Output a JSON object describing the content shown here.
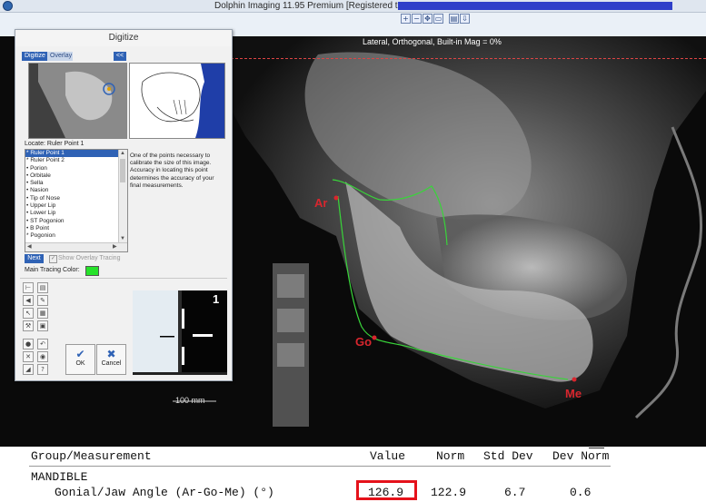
{
  "window": {
    "title": "Dolphin Imaging 11.95 Premium [Registered to:",
    "title_redacted": true
  },
  "toolbar": {
    "buttons": [
      {
        "icon": "zoom-in-icon",
        "glyph": "+"
      },
      {
        "icon": "zoom-out-icon",
        "glyph": "−"
      },
      {
        "icon": "pan-icon",
        "glyph": "✥"
      },
      {
        "icon": "fit-icon",
        "glyph": "▭"
      },
      {
        "icon": "print-icon",
        "glyph": "▤"
      },
      {
        "icon": "export-icon",
        "glyph": "⇩"
      }
    ]
  },
  "image": {
    "caption": "Lateral, Orthogonal, Built-in Mag = 0%",
    "scale_label": "100 mm",
    "landmarks": {
      "ar": "Ar",
      "go": "Go",
      "me": "Me"
    },
    "tracing_color": "#39d43a",
    "landmark_color": "#d8262e"
  },
  "digitize": {
    "title": "Digitize",
    "tabs": [
      "Digitize",
      "Overlay"
    ],
    "collapse_label": "<<",
    "locate_label": "Locate:  Ruler Point 1",
    "points": [
      "* Ruler Point 1",
      "* Ruler Point 2",
      "• Porion",
      "• Orbitale",
      "• Sella",
      "• Nasion",
      "• Tip of Nose",
      "• Upper Lip",
      "• Lower Lip",
      "• ST Pogonion",
      "• B Point",
      "* Pogonion"
    ],
    "selected_index": 0,
    "description": "One of the points necessary to calibrate the size of this image. Accuracy in locating this point determines the accuracy of your final measurements.",
    "next_label": "Next",
    "show_overlay_label": "Show Overlay Tracing",
    "show_overlay_checked": true,
    "main_color_label": "Main Tracing Color:",
    "main_color": "#26e22a",
    "ok_label": "OK",
    "cancel_label": "Cancel",
    "zoom_number": "1",
    "tools": [
      {
        "icon": "ruler-icon",
        "glyph": "⊢"
      },
      {
        "icon": "document-icon",
        "glyph": "▤"
      },
      {
        "icon": "speaker-icon",
        "glyph": "◀"
      },
      {
        "icon": "pencil-icon",
        "glyph": "✎"
      },
      {
        "icon": "pointer-icon",
        "glyph": "↖"
      },
      {
        "icon": "grid-icon",
        "glyph": "▦"
      },
      {
        "icon": "wrench-icon",
        "glyph": "⚒"
      },
      {
        "icon": "stamp-icon",
        "glyph": "▣"
      },
      {
        "icon": "lock-icon",
        "glyph": "●"
      },
      {
        "icon": "undo-icon",
        "glyph": "↶"
      },
      {
        "icon": "delete-icon",
        "glyph": "✕"
      },
      {
        "icon": "globe-icon",
        "glyph": "◉"
      },
      {
        "icon": "chart-icon",
        "glyph": "◢"
      },
      {
        "icon": "help-icon",
        "glyph": "?"
      }
    ]
  },
  "measurements": {
    "headers": {
      "group": "Group/Measurement",
      "value": "Value",
      "norm": "Norm",
      "std_dev": "Std Dev",
      "dev_norm": "Dev Norm"
    },
    "group_name": "MANDIBLE",
    "rows": [
      {
        "name": "Gonial/Jaw Angle (Ar-Go-Me) (°)",
        "value": "126.9",
        "norm": "122.9",
        "std_dev": "6.7",
        "dev_norm": "0.6"
      }
    ]
  }
}
